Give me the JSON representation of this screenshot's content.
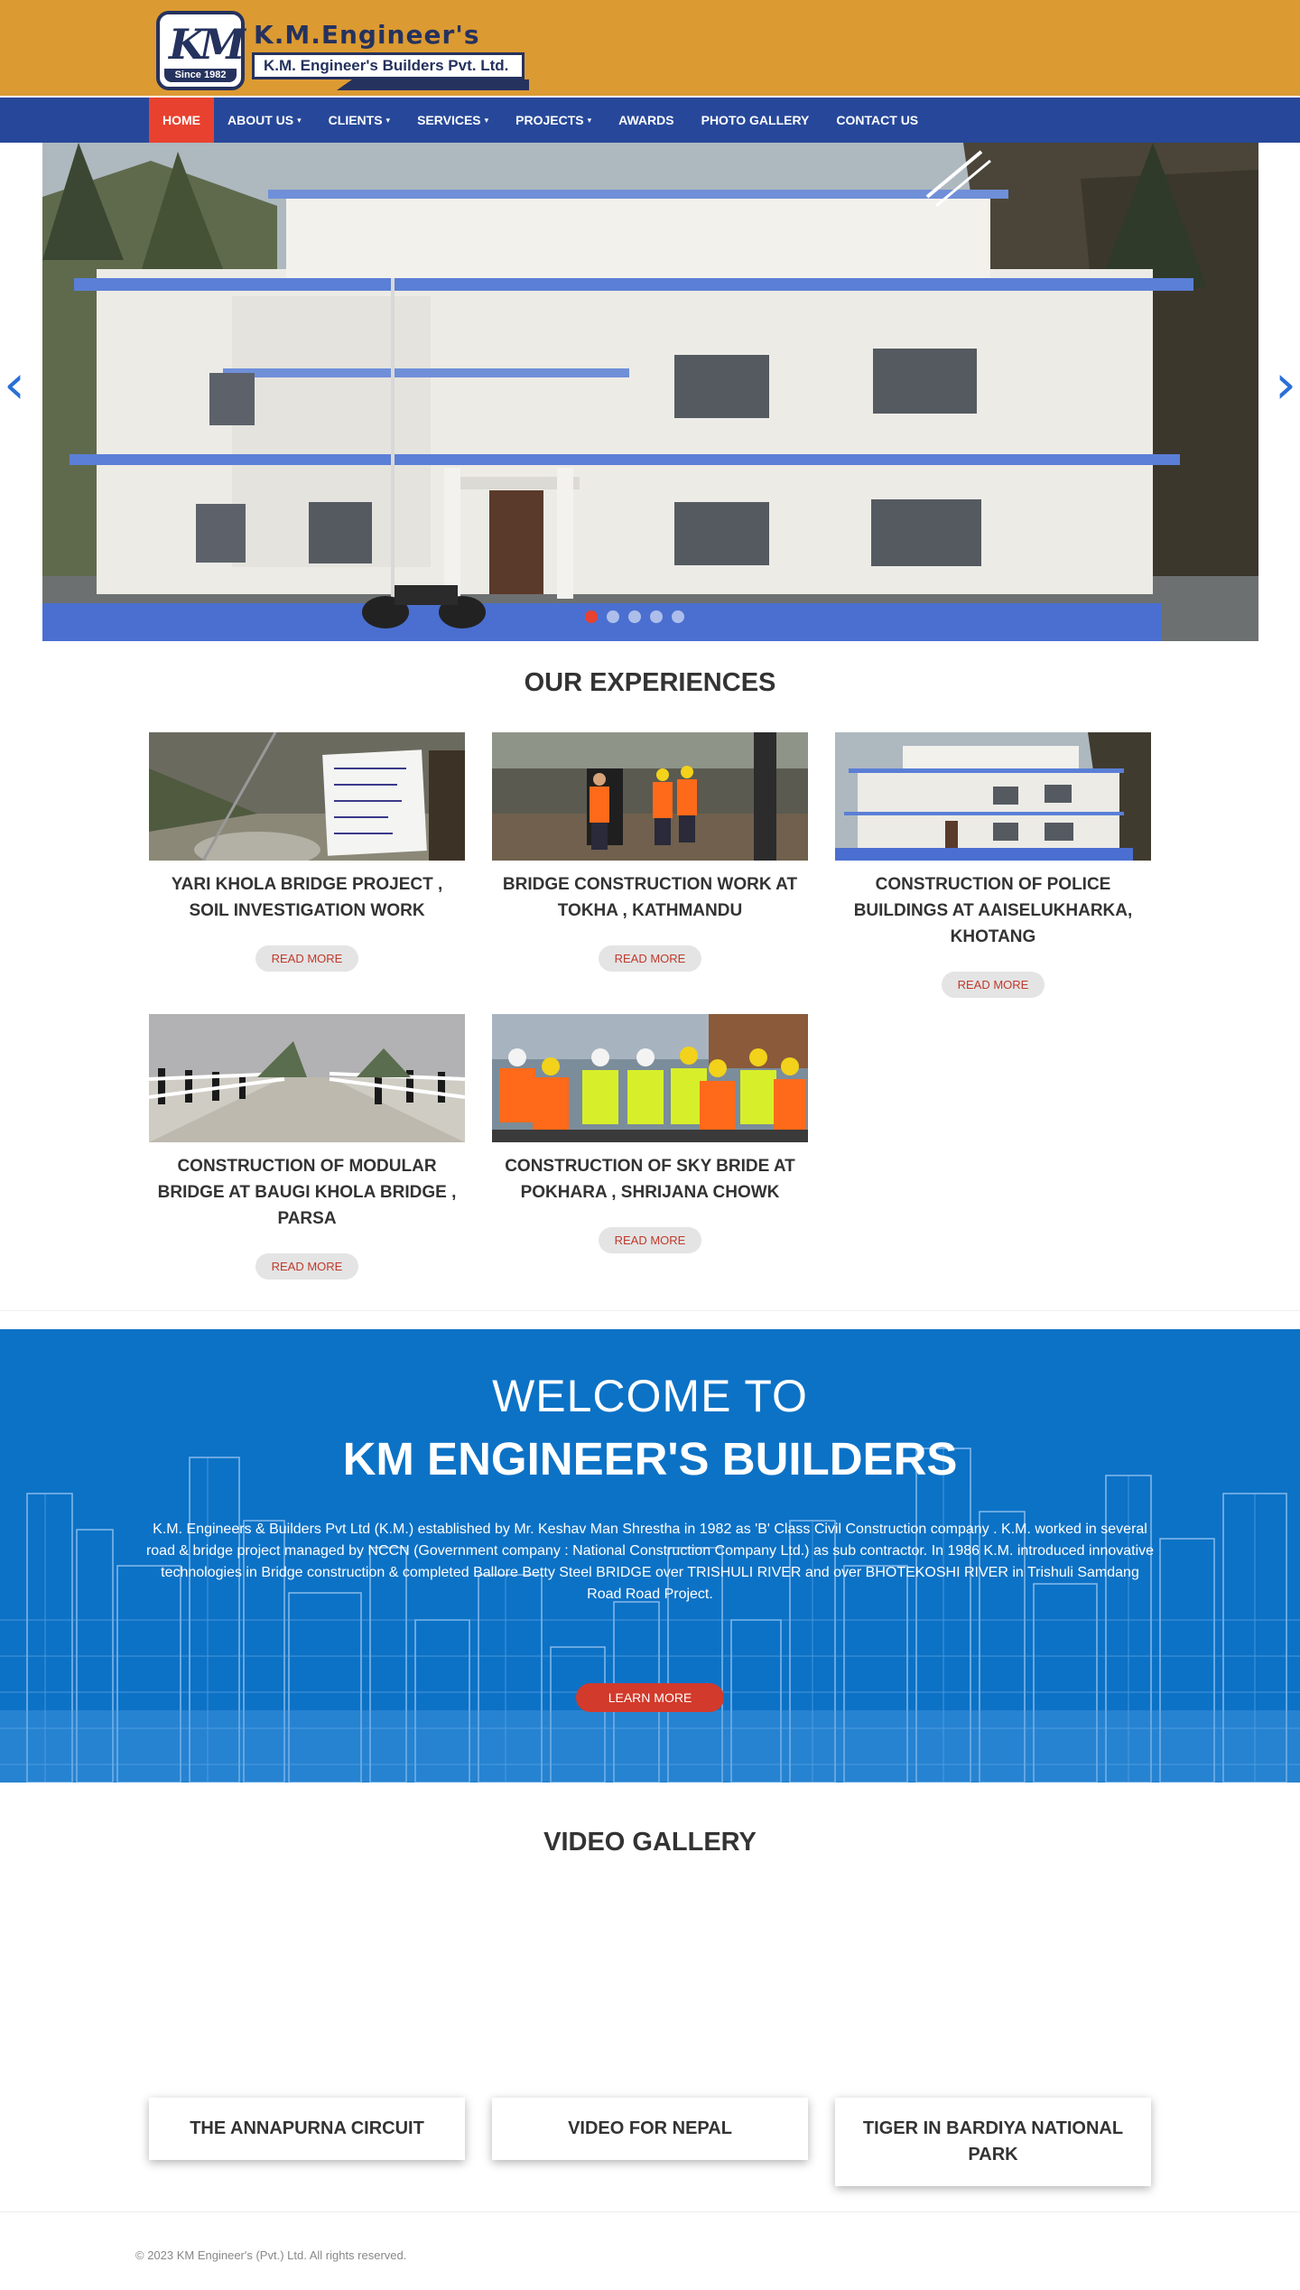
{
  "brand": {
    "logo_initials": "KM",
    "logo_since": "Since 1982",
    "name": "K.M.Engineer's",
    "tagline": "K.M. Engineer's Builders Pvt. Ltd.",
    "colors": {
      "header": "#dc9a32",
      "nav": "#27489a",
      "active": "#e8412f",
      "navy": "#25325e"
    }
  },
  "nav": {
    "items": [
      {
        "label": "HOME",
        "dropdown": false,
        "active": true
      },
      {
        "label": "ABOUT US",
        "dropdown": true,
        "active": false
      },
      {
        "label": "CLIENTS",
        "dropdown": true,
        "active": false
      },
      {
        "label": "SERVICES",
        "dropdown": true,
        "active": false
      },
      {
        "label": "PROJECTS",
        "dropdown": true,
        "active": false
      },
      {
        "label": "AWARDS",
        "dropdown": false,
        "active": false
      },
      {
        "label": "PHOTO GALLERY",
        "dropdown": false,
        "active": false
      },
      {
        "label": "CONTACT US",
        "dropdown": false,
        "active": false
      }
    ],
    "caret_glyph": "▾"
  },
  "slider": {
    "prev_glyph": "‹",
    "next_glyph": "›",
    "slide_count": 5,
    "active_slide": 1
  },
  "experiences": {
    "title": "OUR EXPERIENCES",
    "read_more": "READ MORE",
    "items": [
      {
        "title": "YARI KHOLA BRIDGE PROJECT , SOIL INVESTIGATION WORK"
      },
      {
        "title": "BRIDGE CONSTRUCTION WORK AT TOKHA , KATHMANDU"
      },
      {
        "title": "CONSTRUCTION OF POLICE BUILDINGS AT AAISELUKHARKA, KHOTANG"
      },
      {
        "title": "CONSTRUCTION OF MODULAR BRIDGE AT BAUGI KHOLA BRIDGE , PARSA"
      },
      {
        "title": "CONSTRUCTION OF SKY BRIDE AT POKHARA , SHRIJANA CHOWK"
      }
    ]
  },
  "welcome": {
    "title_line1": "WELCOME TO",
    "title_line2": "KM ENGINEER'S BUILDERS",
    "text": "K.M. Engineers & Builders Pvt Ltd (K.M.) established by Mr. Keshav Man Shrestha in 1982 as 'B' Class Civil Construction company . K.M. worked in several road & bridge project managed by NCCN (Government company : National Construction Company Ltd.) as sub contractor. In 1986 K.M. introduced innovative technologies in Bridge construction & completed Ballore Betty Steel BRIDGE over TRISHULI RIVER and over BHOTEKOSHI RIVER in Trishuli Samdang Road Road Project.",
    "button": "LEARN MORE",
    "color": "#0c72c6"
  },
  "videos": {
    "title": "VIDEO GALLERY",
    "items": [
      {
        "title": "THE ANNAPURNA CIRCUIT"
      },
      {
        "title": "VIDEO FOR NEPAL"
      },
      {
        "title": "TIGER IN BARDIYA NATIONAL PARK"
      }
    ]
  },
  "footer": {
    "copyright": "© 2023 KM Engineer's (Pvt.) Ltd. All rights reserved."
  }
}
